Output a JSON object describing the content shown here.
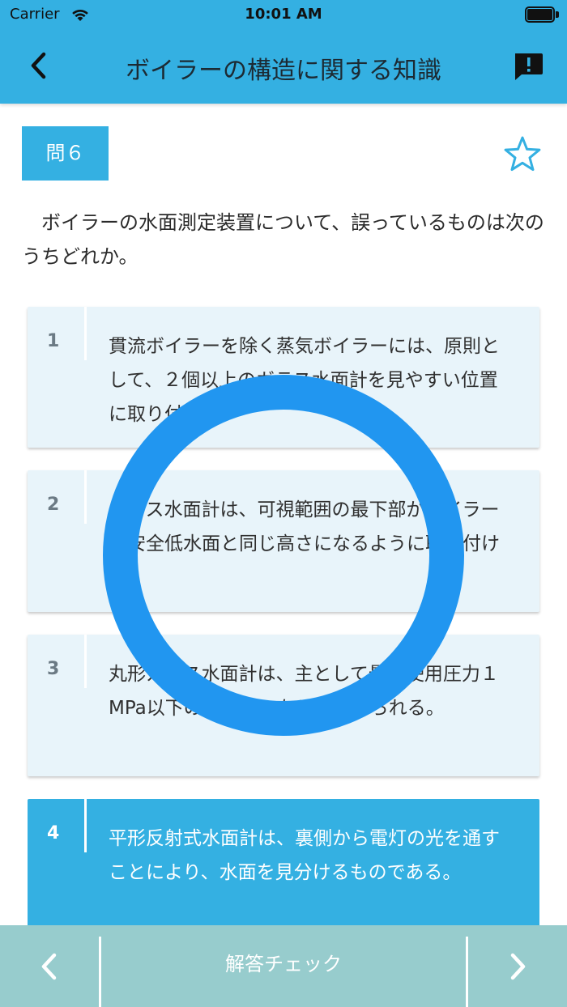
{
  "status_bar": {
    "carrier": "Carrier",
    "time": "10:01 AM"
  },
  "nav": {
    "title": "ボイラーの構造に関する知識",
    "back_icon": "chevron-left-icon",
    "report_icon": "report-icon"
  },
  "question": {
    "number_label": "問６",
    "text": "ボイラーの水面測定装置について、誤っているものは次のうちどれか。",
    "favorite_icon": "star-outline-icon"
  },
  "choices": [
    {
      "num": "1",
      "text": "貫流ボイラーを除く蒸気ボイラーには、原則として、２個以上のガラス水面計を見やすい位置に取り付ける。"
    },
    {
      "num": "2",
      "text": "ガラス水面計は、可視範囲の最下部がボイラーの安全低水面と同じ高さになるように取り付ける。"
    },
    {
      "num": "3",
      "text": "丸形ガラス水面計は、主として最高使用圧力１MPa以下のボイラーなどに用いられる。"
    },
    {
      "num": "4",
      "text": "平形反射式水面計は、裏側から電灯の光を通すことにより、水面を見分けるものである。",
      "selected": true
    }
  ],
  "toolbar": {
    "check_label": "解答チェック",
    "prev_icon": "chevron-left-icon",
    "next_icon": "chevron-right-icon"
  },
  "colors": {
    "accent": "#34b0e2",
    "choice_bg": "#e8f4fa",
    "ring": "#2196f0",
    "toolbar_bg": "#97cccd"
  }
}
